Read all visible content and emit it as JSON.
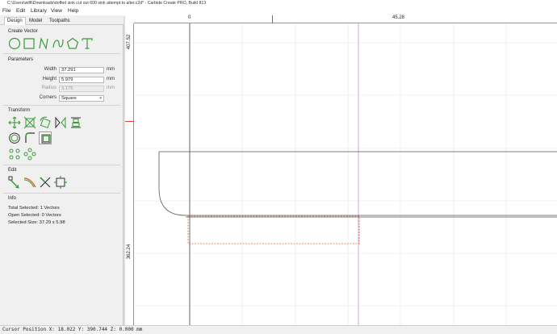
{
  "window": {
    "title": "C:\\Users\\wilfi\\Downloads\\doffed sink cut out 600 sink attempt to alter.c2d* - Carbide Create PRO, Build 813"
  },
  "menu": [
    "File",
    "Edit",
    "Library",
    "View",
    "Help"
  ],
  "tabs": [
    "Design",
    "Model",
    "Toolpaths"
  ],
  "create_vector": {
    "title": "Create Vector",
    "tools": [
      "circle-icon",
      "rectangle-icon",
      "polyline-icon",
      "curve-icon",
      "polygon-icon",
      "text-icon"
    ]
  },
  "parameters": {
    "title": "Parameters",
    "width": {
      "label": "Width",
      "value": "37.291",
      "unit": "mm"
    },
    "height": {
      "label": "Height",
      "value": "5.979",
      "unit": "mm"
    },
    "radius": {
      "label": "Radius",
      "value": "3.175",
      "unit": "mm"
    },
    "corners": {
      "label": "Corners",
      "value": "Square"
    }
  },
  "transform": {
    "title": "Transform",
    "tools_row1": [
      "move-icon",
      "scale-icon",
      "rotate-icon",
      "mirror-icon",
      "align-icon"
    ],
    "tools_row2": [
      "offset-icon",
      "fillet-icon",
      "boundary-icon"
    ],
    "tools_row3": [
      "circular-array-icon",
      "grid-array-icon"
    ]
  },
  "edit": {
    "title": "Edit",
    "tools": [
      "node-edit-icon",
      "knife-icon",
      "trim-icon",
      "join-icon"
    ]
  },
  "info": {
    "title": "Info",
    "total_selected": "Total Selected:   1 Vectors",
    "open_selected": "Open Selected:   0 Vectors",
    "selected_size": "Selected Size:   37.29 x 5.98"
  },
  "rulers": {
    "h_labels": [
      "0",
      "45.28"
    ],
    "v_labels": [
      "407.52",
      "362.24"
    ]
  },
  "status": "Cursor Position X: 18.022 Y: 390.744 Z: 0.000 mm",
  "colors": {
    "accent_green": "#3a9a3a",
    "selection_orange": "#e26a2c",
    "ruler_marker": "#e53935",
    "guide_magenta": "#d08ad0"
  }
}
